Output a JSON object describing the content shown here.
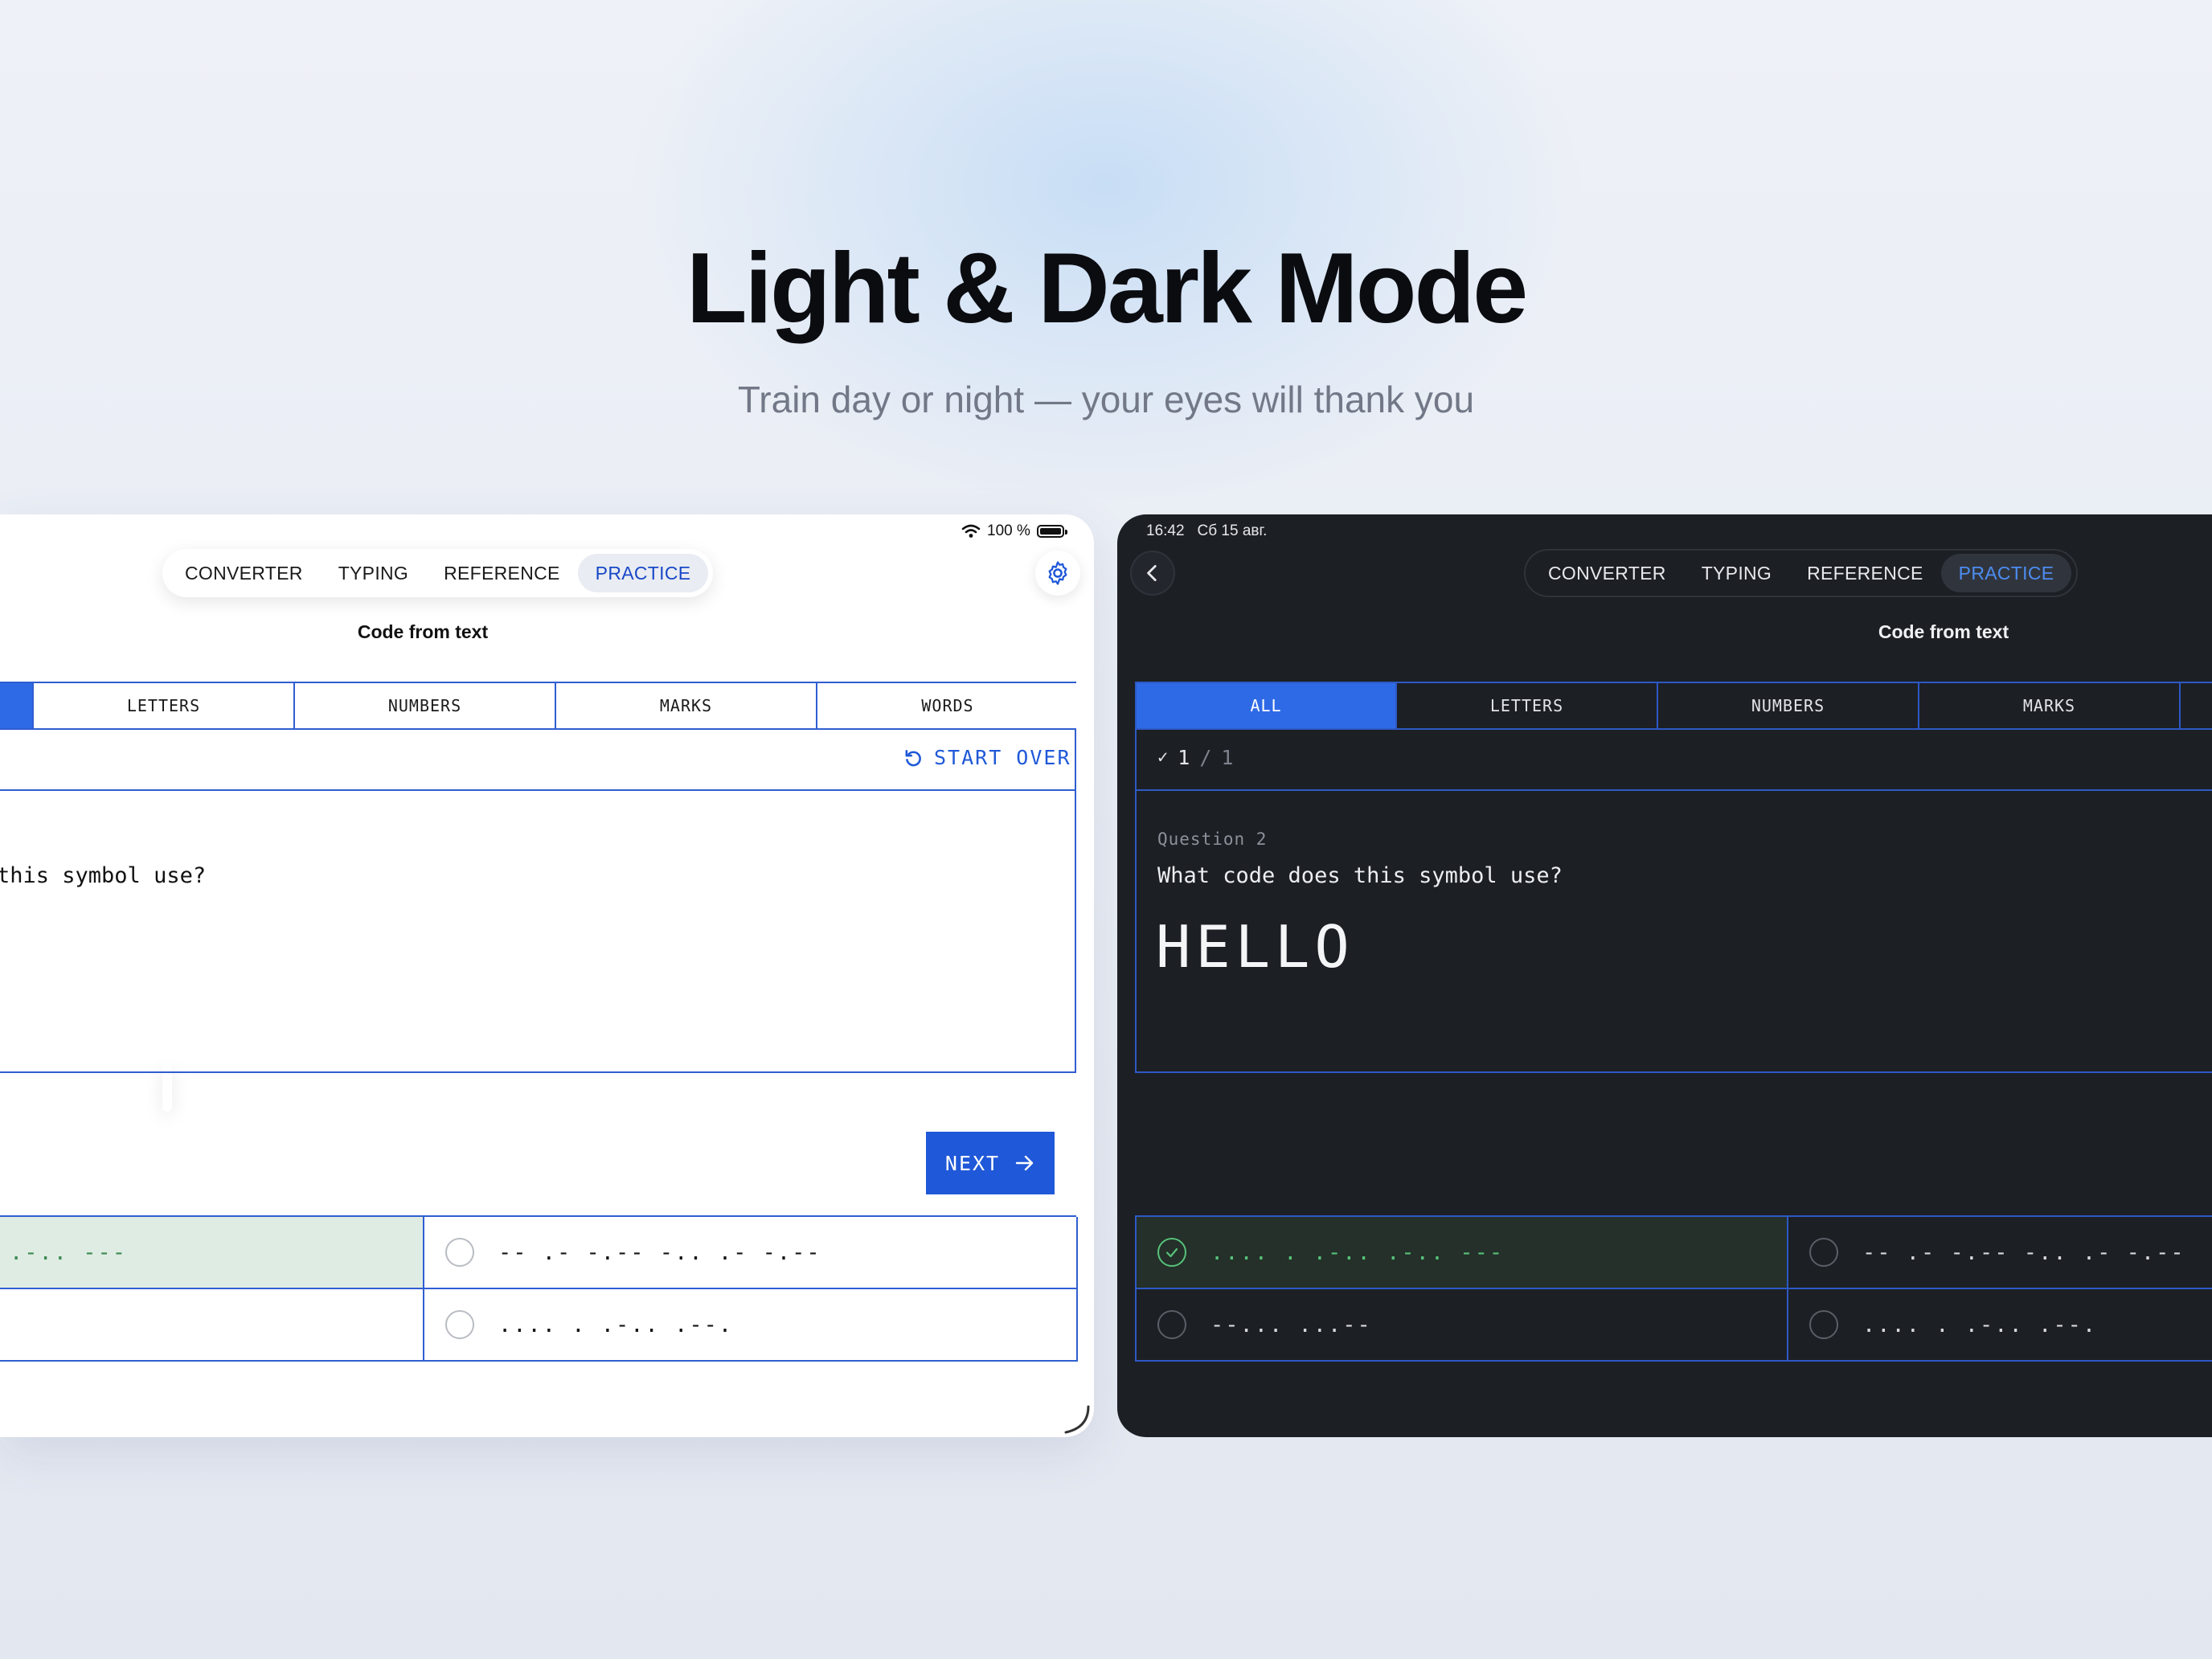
{
  "hero": {
    "title": "Light & Dark Mode",
    "subtitle": "Train day or night — your eyes will thank you"
  },
  "nav_tabs": [
    "CONVERTER",
    "TYPING",
    "REFERENCE",
    "PRACTICE"
  ],
  "screen_title": "Code from text",
  "light": {
    "status": {
      "battery": "100 %"
    },
    "filters": [
      "LETTERS",
      "NUMBERS",
      "MARKS",
      "WORDS"
    ],
    "start_over": "START OVER",
    "question_text": "this symbol use?",
    "next_label": "NEXT",
    "answers": [
      ".-.. ---",
      "-- .- -.-- -.. .- -.--",
      "",
      ".... . .-.. .--."
    ]
  },
  "dark": {
    "status": {
      "time": "16:42",
      "date": "Сб 15 авг."
    },
    "filters": [
      "ALL",
      "LETTERS",
      "NUMBERS",
      "MARKS"
    ],
    "score": {
      "check": "✓",
      "correct": "1",
      "sep": "/",
      "total": "1"
    },
    "question_number": "Question 2",
    "question_text": "What code does this symbol use?",
    "symbol": "HELLO",
    "answers": [
      ".... . .-.. .-.. ---",
      "-- .- -.-- -.. .- -.--",
      "--... ...--",
      ".... . .-.. .--."
    ]
  },
  "colors": {
    "accent": "#1f58d8",
    "active_filter": "#2f6ae6",
    "correct_green": "#57c27a",
    "dark_bg": "#1c1f24"
  },
  "icons": [
    "wifi-icon",
    "battery-icon",
    "gear-icon",
    "back-chevron-icon",
    "refresh-icon",
    "arrow-right-icon",
    "check-icon"
  ]
}
